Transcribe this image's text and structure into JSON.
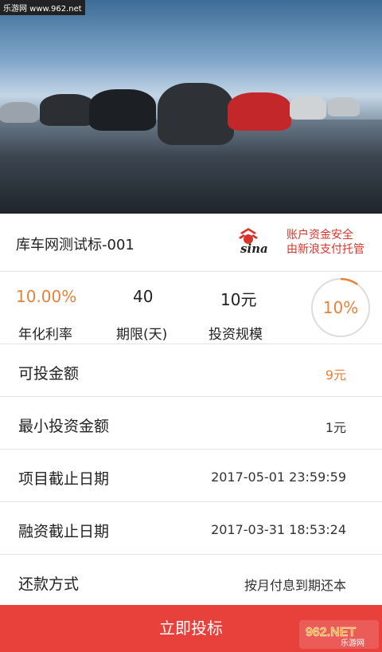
{
  "hero": {
    "watermark": "乐游网 www.962.net"
  },
  "product": {
    "title": "库车网测试标-001",
    "sina_line1": "账户资金安全",
    "sina_line2": "由新浪支付托管"
  },
  "stats": {
    "rate_value": "10.00%",
    "rate_label": "年化利率",
    "term_value": "40",
    "term_label": "期限(天)",
    "scale_value": "10元",
    "scale_label": "投资规模",
    "progress_text": "10%",
    "progress_fraction": 0.1
  },
  "details": [
    {
      "label": "可投金额",
      "value": "9元"
    },
    {
      "label": "最小投资金额",
      "value": "1元"
    },
    {
      "label": "项目截止日期",
      "value": "2017-05-01 23:59:59"
    },
    {
      "label": "融资截止日期",
      "value": "2017-03-31 18:53:24"
    },
    {
      "label": "还款方式",
      "value": "按月付息到期还本"
    }
  ],
  "cta": {
    "label": "立即投标"
  },
  "badge": {
    "text": "962.NET",
    "sub": "乐游网"
  },
  "colors": {
    "accent": "#e8813a",
    "cta": "#e8403b",
    "sina_red": "#d9342b"
  }
}
